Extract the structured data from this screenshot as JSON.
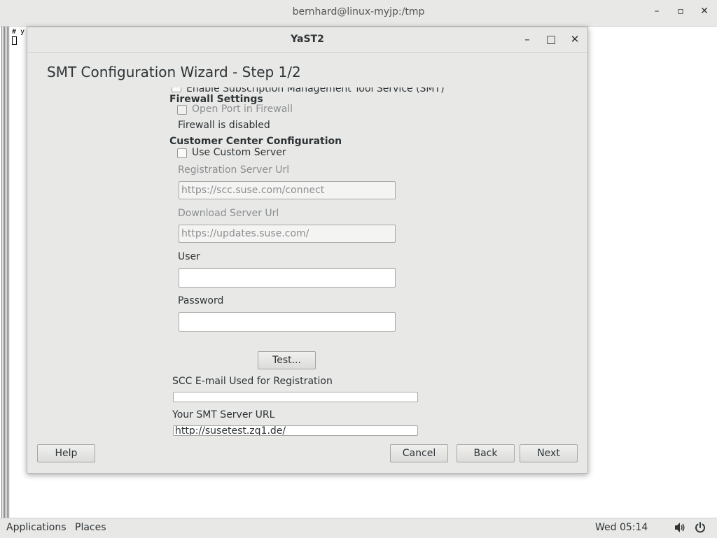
{
  "terminal": {
    "title": "bernhard@linux-myjp:/tmp",
    "text": "# y",
    "controls": {
      "minimize": "–",
      "maximize": "▫",
      "close": "✕"
    }
  },
  "dialog": {
    "title": "YaST2",
    "controls": {
      "minimize": "–",
      "maximize": "□",
      "close": "✕"
    },
    "wizard_title": "SMT Configuration Wizard - Step 1/2",
    "enable_smt": {
      "label": "Enable Subscription Management Tool Service (SMT)",
      "checked": true
    },
    "firewall": {
      "heading": "Firewall Settings",
      "open_port_label": "Open Port in Firewall",
      "status": "Firewall is disabled"
    },
    "customer_center": {
      "heading": "Customer Center Configuration",
      "use_custom_server_label": "Use Custom Server",
      "registration_url_label": "Registration Server Url",
      "registration_url_value": "https://scc.suse.com/connect",
      "download_url_label": "Download Server Url",
      "download_url_value": "https://updates.suse.com/",
      "user_label": "User",
      "user_value": "",
      "password_label": "Password",
      "password_value": "",
      "test_button": "Test..."
    },
    "scc_email_label": "SCC E-mail Used for Registration",
    "scc_email_value": "",
    "smt_url_label": "Your SMT Server URL",
    "smt_url_value": "http://susetest.zq1.de/",
    "buttons": {
      "help": "Help",
      "cancel": "Cancel",
      "back": "Back",
      "next": "Next"
    }
  },
  "panel": {
    "applications": "Applications",
    "places": "Places",
    "clock": "Wed 05:14",
    "volume_icon": "volume-icon",
    "power_icon": "power-icon"
  }
}
